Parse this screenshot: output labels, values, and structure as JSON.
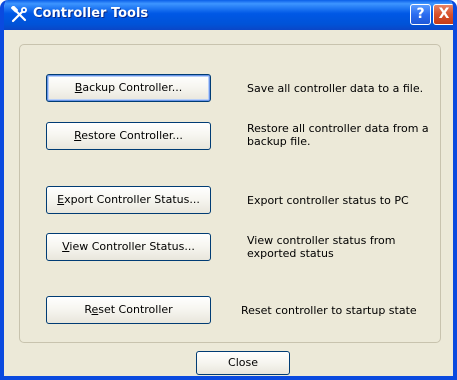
{
  "window": {
    "title": "Controller Tools",
    "help_glyph": "?",
    "close_glyph": "X",
    "icon": "tools-icon"
  },
  "actions": [
    {
      "pre": "",
      "mn": "B",
      "post": "ackup Controller...",
      "description": "Save all controller data to a file."
    },
    {
      "pre": "",
      "mn": "R",
      "post": "estore Controller...",
      "description": "Restore all controller data from a\nbackup file."
    },
    {
      "pre": "",
      "mn": "E",
      "post": "xport Controller Status...",
      "description": "Export controller status to PC"
    },
    {
      "pre": "",
      "mn": "V",
      "post": "iew Controller Status...",
      "description": "View controller status from\nexported status"
    },
    {
      "pre": "R",
      "mn": "e",
      "post": "set Controller",
      "description": "Reset controller to startup state"
    }
  ],
  "footer": {
    "close_label": "Close"
  },
  "colors": {
    "titlebar": "#0058e6",
    "dialog_bg": "#ece9d8",
    "button_border": "#003c74"
  }
}
